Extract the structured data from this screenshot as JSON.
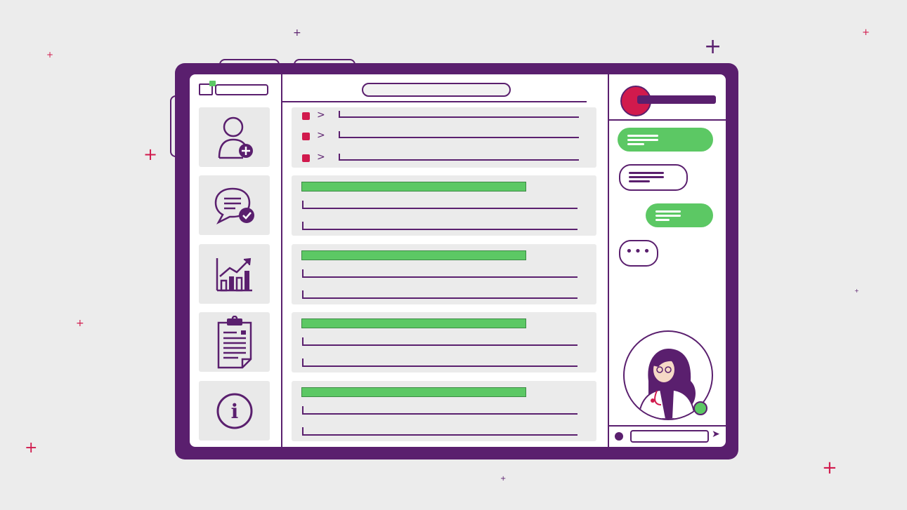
{
  "colors": {
    "background": "#ececec",
    "frame": "#5a1f6e",
    "accent_green": "#5cc864",
    "accent_red": "#d11a4d",
    "tile": "#e9e9e9"
  },
  "nav": [
    {
      "id": "users",
      "icon": "add-user-icon"
    },
    {
      "id": "messages",
      "icon": "chat-check-icon"
    },
    {
      "id": "analytics",
      "icon": "chart-growth-icon"
    },
    {
      "id": "reports",
      "icon": "clipboard-icon"
    },
    {
      "id": "info",
      "icon": "info-icon",
      "glyph": "i"
    }
  ],
  "list_rows": 3,
  "record_cards": 4,
  "chat": {
    "messages": [
      {
        "side": "left",
        "style": "green"
      },
      {
        "side": "left",
        "style": "white"
      },
      {
        "side": "right",
        "style": "green"
      },
      {
        "side": "left",
        "style": "typing",
        "text": "•••"
      }
    ],
    "send_icon": "send-icon",
    "emoji_icon": "smiley-icon",
    "contact_icon": "doctor-avatar-icon"
  }
}
